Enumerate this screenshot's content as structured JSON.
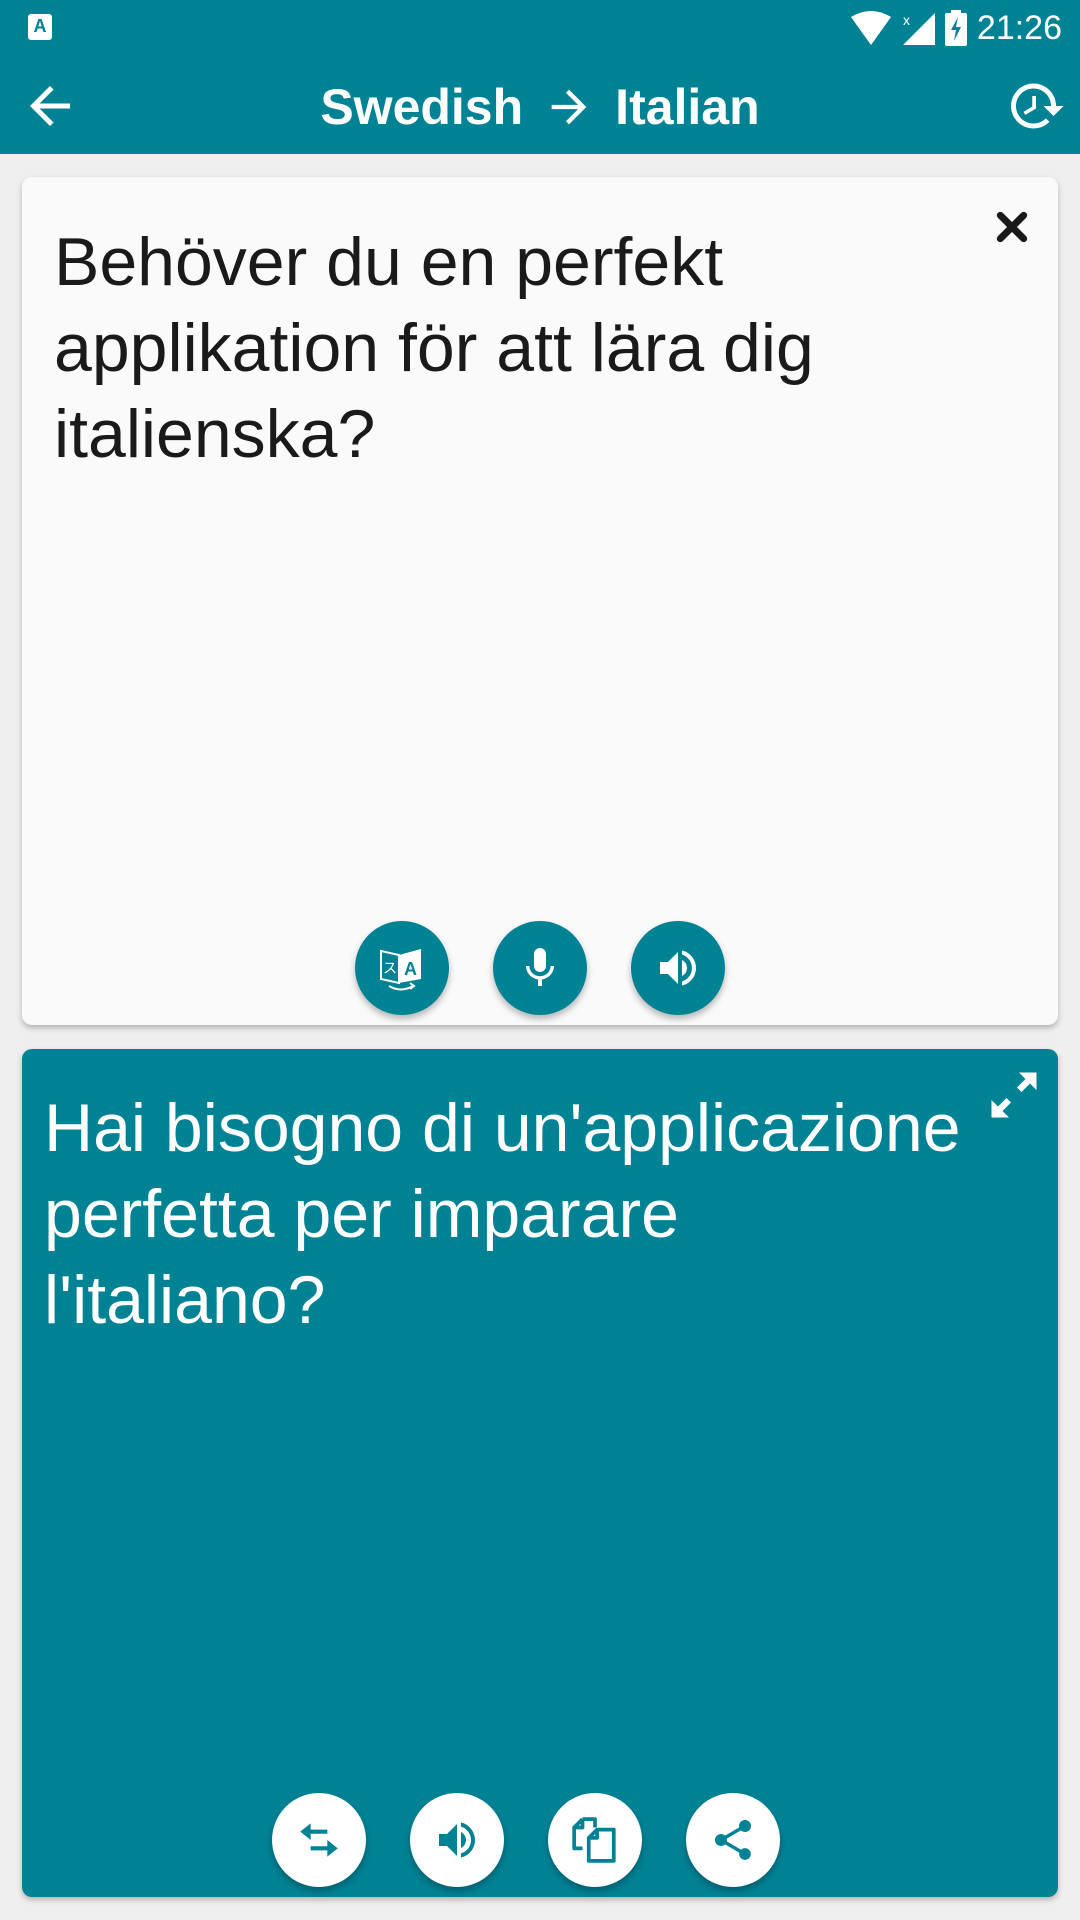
{
  "status_bar": {
    "app_indicator": "A",
    "time": "21:26",
    "icons": [
      "wifi-icon",
      "signal-no-data-icon",
      "battery-charging-icon"
    ]
  },
  "app_bar": {
    "source_language": "Swedish",
    "arrow": "→",
    "target_language": "Italian",
    "back_icon": "arrow-back-icon",
    "history_icon": "history-icon"
  },
  "source_card": {
    "text": "Behöver du en perfekt applikation för att lära dig italienska?",
    "clear_icon": "close-icon",
    "actions": [
      {
        "name": "translate-button",
        "icon": "translate-icon"
      },
      {
        "name": "microphone-button",
        "icon": "microphone-icon"
      },
      {
        "name": "speak-source-button",
        "icon": "speaker-icon"
      }
    ]
  },
  "target_card": {
    "text": "Hai bisogno di un'applicazione perfetta per imparare l'italiano?",
    "expand_icon": "fullscreen-expand-icon",
    "actions": [
      {
        "name": "swap-languages-button",
        "icon": "swap-icon"
      },
      {
        "name": "speak-target-button",
        "icon": "speaker-icon"
      },
      {
        "name": "copy-button",
        "icon": "copy-icon"
      },
      {
        "name": "share-button",
        "icon": "share-icon"
      }
    ]
  },
  "colors": {
    "primary": "#008295",
    "source_card_bg": "#fafafa",
    "page_bg": "#efefef",
    "text_dark": "#1a1a1a",
    "text_light": "#ffffff"
  }
}
